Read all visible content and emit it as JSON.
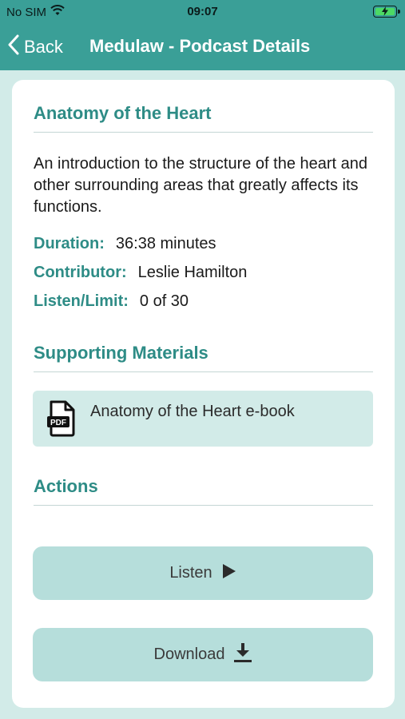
{
  "status": {
    "carrier": "No SIM",
    "time": "09:07"
  },
  "nav": {
    "back_label": "Back",
    "title": "Medulaw - Podcast Details"
  },
  "podcast": {
    "title": "Anatomy of the Heart",
    "description": "An introduction to the structure of the heart and other surrounding areas that greatly affects its functions.",
    "duration_label": "Duration:",
    "duration_value": "36:38 minutes",
    "contributor_label": "Contributor:",
    "contributor_value": "Leslie Hamilton",
    "listen_label": "Listen/Limit:",
    "listen_value": "0 of 30"
  },
  "materials": {
    "heading": "Supporting Materials",
    "items": [
      {
        "label": "Anatomy of the Heart e-book",
        "icon": "pdf-icon"
      }
    ]
  },
  "actions": {
    "heading": "Actions",
    "listen_label": "Listen",
    "download_label": "Download"
  },
  "colors": {
    "accent": "#3a9f97",
    "heading": "#2e8c86",
    "button_bg": "#b6dedb",
    "page_bg": "#d2ebe8"
  }
}
